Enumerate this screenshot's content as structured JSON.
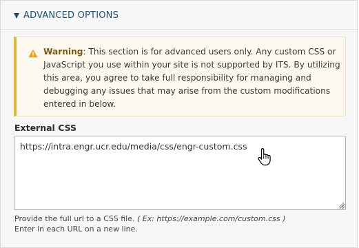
{
  "section": {
    "title": "ADVANCED OPTIONS"
  },
  "warning": {
    "label": "Warning",
    "colon": ":",
    "message": " This section is for advanced users only. Any custom CSS or JavaScript you use within your site is not supported by ITS. By utilizing this area, you agree to take full responsibility for managing and debugging any issues that may arise from the custom modifications entered in below."
  },
  "external_css": {
    "label": "External CSS",
    "value": "https://intra.engr.ucr.edu/media/css/engr-custom.css",
    "help_line1_prefix": "Provide the full url to a CSS file. ",
    "help_line1_example": "( Ex: https://example.com/custom.css )",
    "help_line2": "Enter in each URL on a new line."
  },
  "colors": {
    "accent": "#1f4e73",
    "warning_border": "#e6b43c",
    "warning_bg": "#fdf8ed",
    "warning_label": "#7a5a17"
  },
  "icons": {
    "caret": "triangle-down-icon",
    "warning": "warning-triangle-icon",
    "cursor": "hand-pointer-icon",
    "grip": "resize-grip-icon"
  }
}
